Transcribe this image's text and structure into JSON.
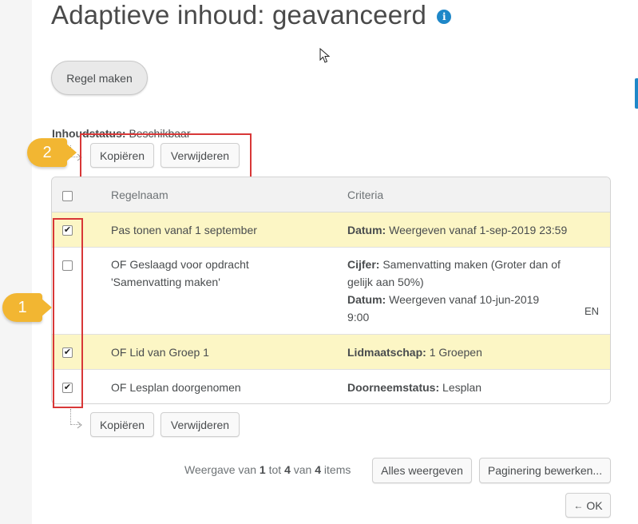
{
  "page": {
    "title": "Adaptieve inhoud: geavanceerd",
    "info_icon": "i"
  },
  "toolbar": {
    "create_rule_label": "Regel maken"
  },
  "status": {
    "label": "Inhoudstatus:",
    "value": "Beschikbaar"
  },
  "actions_top": {
    "copy_label": "Kopiëren",
    "delete_label": "Verwijderen"
  },
  "actions_bottom": {
    "copy_label": "Kopiëren",
    "delete_label": "Verwijderen"
  },
  "callouts": {
    "one": "1",
    "two": "2"
  },
  "table": {
    "headers": {
      "name": "Regelnaam",
      "criteria": "Criteria"
    },
    "rows": [
      {
        "checked": true,
        "name": "Pas tonen vanaf 1 september",
        "criteria": [
          {
            "label": "Datum:",
            "value": "Weergeven vanaf 1-sep-2019 23:59"
          }
        ]
      },
      {
        "checked": false,
        "name_line1": "OF Geslaagd voor opdracht",
        "name_line2": "'Samenvatting maken'",
        "criteria_line1_label": "Cijfer:",
        "criteria_line1_value": "Samenvatting maken (Groter dan of",
        "criteria_line2": "gelijk aan 50%)",
        "criteria_line3_label": "Datum:",
        "criteria_line3_value": "Weergeven vanaf 10-jun-2019",
        "criteria_line4": "9:00",
        "lang": "EN"
      },
      {
        "checked": true,
        "name": "OF Lid van Groep 1",
        "criteria": [
          {
            "label": "Lidmaatschap:",
            "value": "1 Groepen"
          }
        ]
      },
      {
        "checked": true,
        "name": "OF Lesplan doorgenomen",
        "criteria": [
          {
            "label": "Doorneemstatus:",
            "value": "Lesplan"
          }
        ]
      }
    ]
  },
  "pagination": {
    "prefix": "Weergave van",
    "from": "1",
    "to_word": "tot",
    "to": "4",
    "of_word": "van",
    "total": "4",
    "suffix": "items",
    "show_all_label": "Alles weergeven",
    "edit_paging_label": "Paginering bewerken..."
  },
  "footer": {
    "ok_label": "OK"
  },
  "colors": {
    "selected_row": "#fcf6c5",
    "callout": "#f2b632",
    "highlight_box": "#d83737",
    "info_icon": "#1e87c8"
  }
}
